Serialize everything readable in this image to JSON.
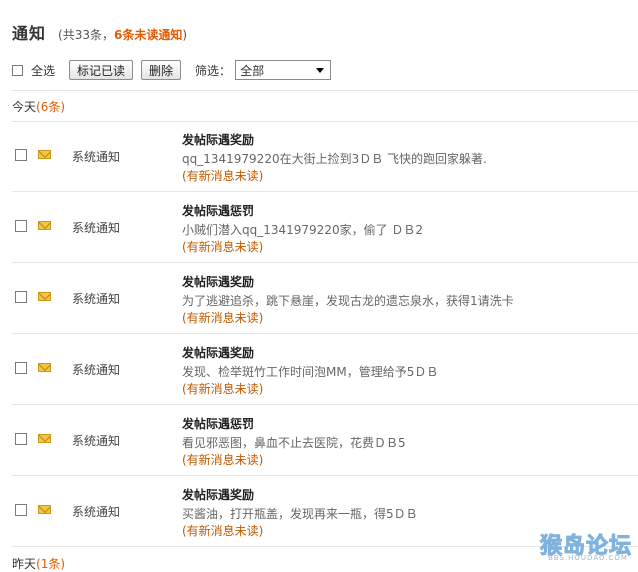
{
  "header": {
    "title": "通知",
    "subtitle_prefix": "(共33条，",
    "subtitle_unread": "6条未读通知",
    "subtitle_suffix": ")"
  },
  "toolbar": {
    "select_all_label": "全选",
    "mark_read_button": "标记已读",
    "delete_button": "删除",
    "filter_label": "筛选：",
    "filter_value": "全部"
  },
  "groups": {
    "today_label": "今天",
    "today_count": "(6条)",
    "yesterday_label": "昨天",
    "yesterday_count": "(1条)"
  },
  "notifications": [
    {
      "category": "系统通知",
      "title": "发帖际遇奖励",
      "body": "qq_1341979220在大街上捡到3ＤＢ  飞快的跑回家躲著.",
      "status": "(有新消息未读)"
    },
    {
      "category": "系统通知",
      "title": "发帖际遇惩罚",
      "body": "小贼们潜入qq_1341979220家，偷了 ＤＢ2",
      "status": "(有新消息未读)"
    },
    {
      "category": "系统通知",
      "title": "发帖际遇奖励",
      "body": "为了逃避追杀，跳下悬崖，发现古龙的遗忘泉水，获得1请洗卡",
      "status": "(有新消息未读)"
    },
    {
      "category": "系统通知",
      "title": "发帖际遇奖励",
      "body": "发现、检举斑竹工作时间泡MM，管理给予5ＤＢ",
      "status": "(有新消息未读)"
    },
    {
      "category": "系统通知",
      "title": "发帖际遇惩罚",
      "body": "看见邪恶图，鼻血不止去医院，花费ＤＢ5",
      "status": "(有新消息未读)"
    },
    {
      "category": "系统通知",
      "title": "发帖际遇奖励",
      "body": "买酱油，打开瓶盖，发现再来一瓶，得5ＤＢ",
      "status": "(有新消息未读)"
    }
  ],
  "watermark": {
    "logo_text": "猴岛论坛",
    "url_text": "BBS.HOUDAO.COM"
  }
}
